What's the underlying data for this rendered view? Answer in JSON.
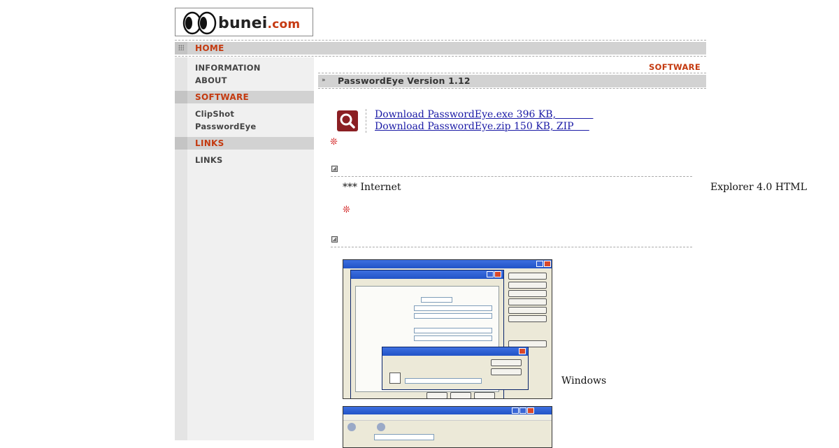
{
  "logo": {
    "brand": "bunei",
    "tld": ".com"
  },
  "nav": {
    "home": "HOME",
    "sections": [
      {
        "heading": "",
        "items": [
          "INFORMATION",
          "ABOUT"
        ]
      },
      {
        "heading": "SOFTWARE",
        "items": [
          "ClipShot",
          "PasswordEye"
        ]
      },
      {
        "heading": "LINKS",
        "items": [
          "LINKS"
        ]
      }
    ]
  },
  "content": {
    "section_label": "SOFTWARE",
    "title": "PasswordEye Version 1.12",
    "downloads": [
      "Download PasswordEye.exe 396 KB,            ",
      "Download PasswordEye.zip 150 KB, ZIP     "
    ],
    "mark_glyph": "❊",
    "para1_left": "*** Internet",
    "para1_right": "Explorer 4.0 HTML",
    "screenshot_caption": "Windows"
  },
  "colors": {
    "accent": "#c43a10",
    "bar": "#d2d2d2",
    "sidebar": "#f0f0f0",
    "link": "#1a1aa6",
    "icon_bg": "#8b1f23"
  },
  "icons": {
    "search": "magnifier-icon",
    "bullet": "square-bullet-icon"
  }
}
